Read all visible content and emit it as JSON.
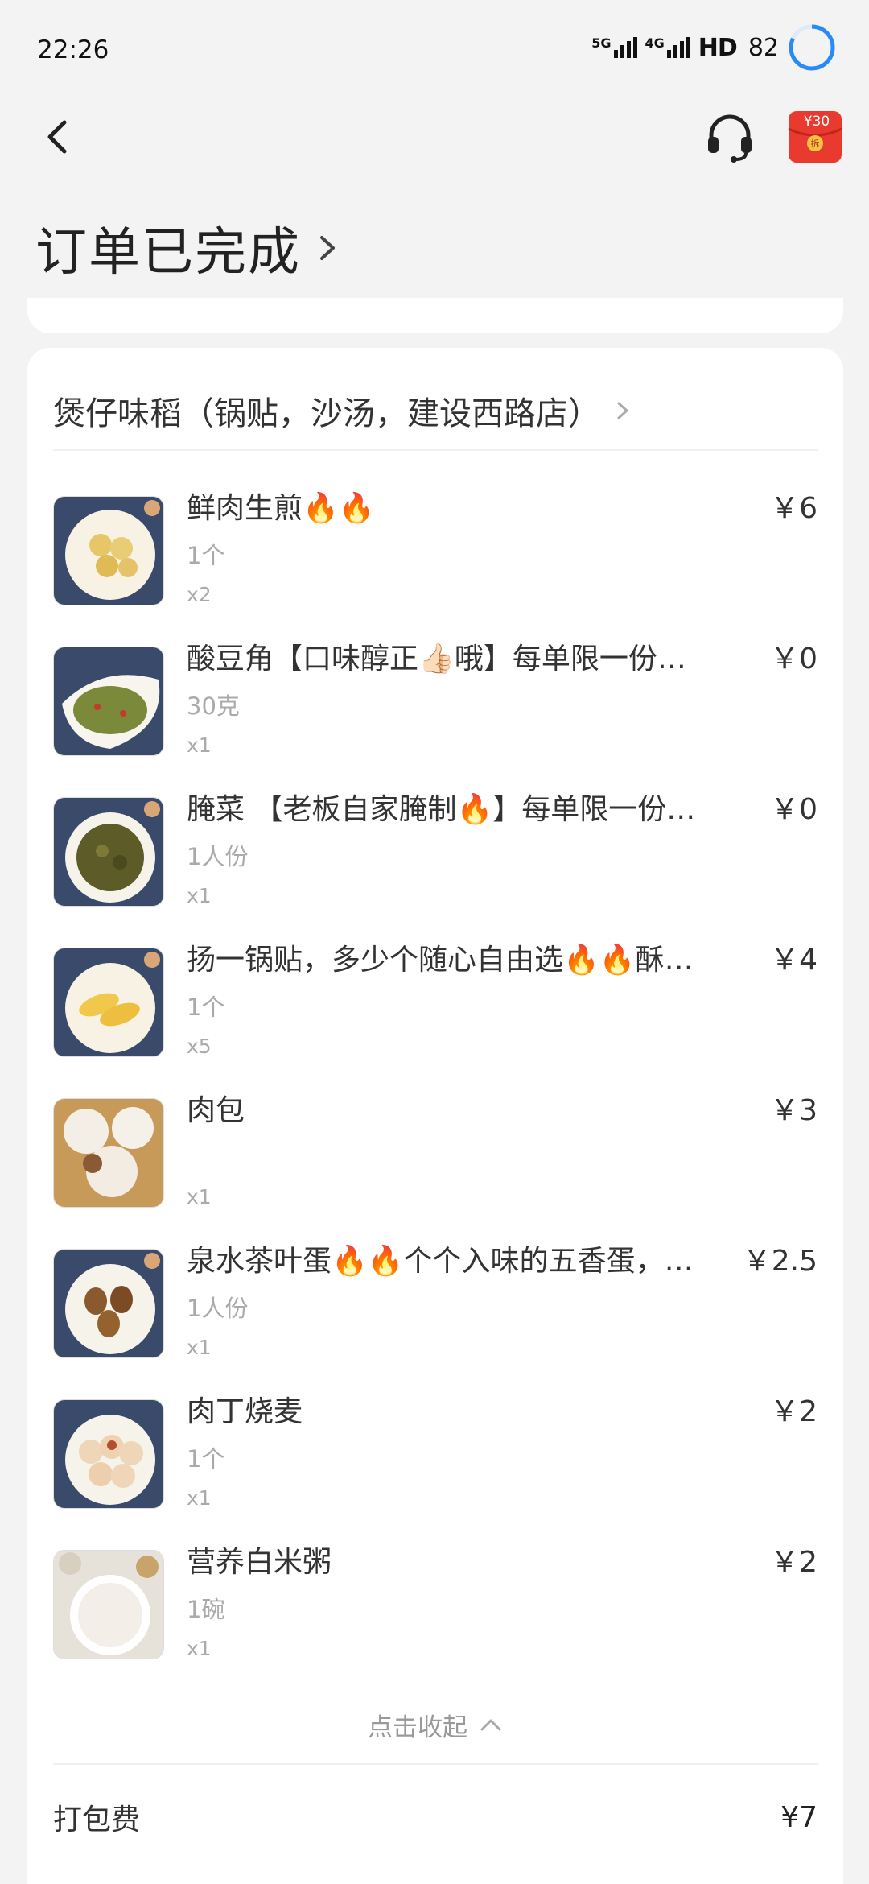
{
  "status_bar": {
    "time": "22:26",
    "network_5g": "5G",
    "network_4g": "4G",
    "hd": "HD",
    "battery": "82"
  },
  "header": {
    "order_status": "订单已完成",
    "redpacket_amount": "¥30"
  },
  "shop": {
    "name": "煲仔味稻（锅贴，沙汤，建设西路店）"
  },
  "items": [
    {
      "name": "鲜肉生煎🔥🔥",
      "price": "￥6",
      "spec": "1个",
      "qty": "x2"
    },
    {
      "name": "酸豆角【口味醇正👍🏻哦】每单限一份，每单限一份",
      "price": "￥0",
      "spec": "30克",
      "qty": "x1"
    },
    {
      "name": "腌菜 【老板自家腌制🔥】每单限一份，每单限一份",
      "price": "￥0",
      "spec": "1人份",
      "qty": "x1"
    },
    {
      "name": "扬一锅贴，多少个随心自由选🔥🔥酥脆可口",
      "price": "￥4",
      "spec": "1个",
      "qty": "x5"
    },
    {
      "name": "肉包",
      "price": "￥3",
      "spec": "",
      "qty": "x1"
    },
    {
      "name": "泉水茶叶蛋🔥🔥个个入味的五香蛋，入味好吃",
      "price": "￥2.5",
      "spec": "1人份",
      "qty": "x1"
    },
    {
      "name": "肉丁烧麦",
      "price": "￥2",
      "spec": "1个",
      "qty": "x1"
    },
    {
      "name": "营养白米粥",
      "price": "￥2",
      "spec": "1碗",
      "qty": "x1"
    }
  ],
  "collapse_label": "点击收起",
  "fees": {
    "packing_label": "打包费",
    "packing_value": "¥7"
  },
  "icons": {
    "back": "back-arrow-icon",
    "support": "headset-icon",
    "redpacket": "red-packet-icon",
    "shop_chevron": "chevron-right-icon",
    "collapse": "chevron-up-icon"
  },
  "colors": {
    "background": "#f3f3f3",
    "card": "#ffffff",
    "battery_ring": "#2a8af6",
    "redpacket": "#e83a2f"
  }
}
